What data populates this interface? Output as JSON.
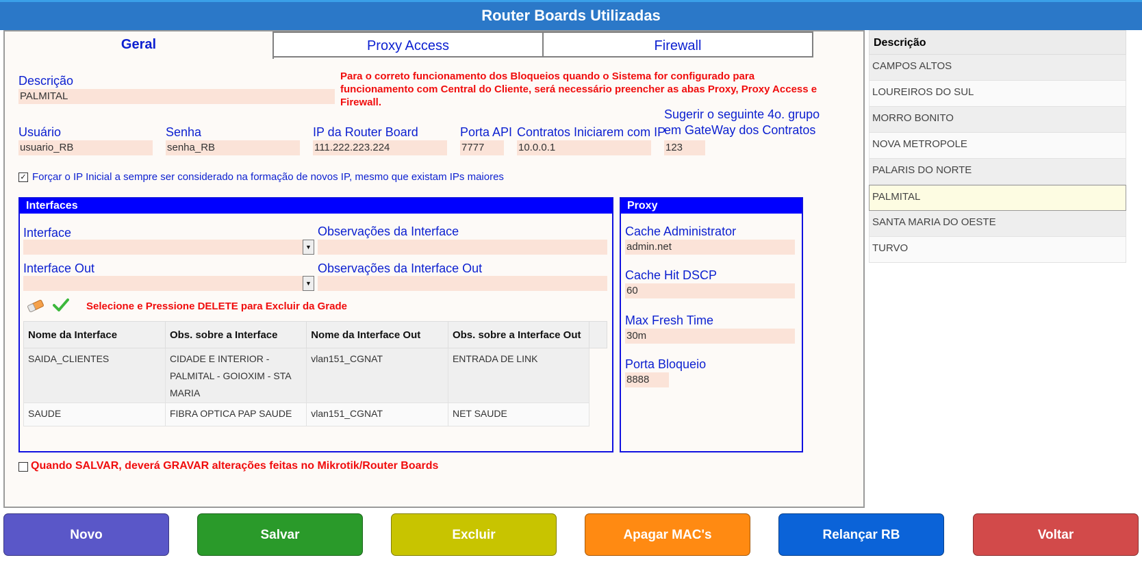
{
  "window": {
    "title": "Router Boards Utilizadas"
  },
  "tabs": [
    {
      "label": "Geral",
      "active": true
    },
    {
      "label": "Proxy Access",
      "active": false
    },
    {
      "label": "Firewall",
      "active": false
    }
  ],
  "form": {
    "descricao": {
      "label": "Descrição",
      "value": "PALMITAL"
    },
    "warning": "Para o correto funcionamento dos Bloqueios quando o Sistema for configurado para funcionamento com Central do Cliente, será necessário preencher as abas Proxy, Proxy Access e Firewall.",
    "usuario": {
      "label": "Usuário",
      "value": "usuario_RB"
    },
    "senha": {
      "label": "Senha",
      "value": "senha_RB"
    },
    "ip_router": {
      "label": "IP da Router Board",
      "value": "111.222.223.224"
    },
    "porta_api": {
      "label": "Porta API",
      "value": "7777"
    },
    "contratos_ip": {
      "label": "Contratos Iniciarem com IP",
      "value": "10.0.0.1"
    },
    "sugerir": {
      "label_line1": "Sugerir o seguinte 4o. grupo",
      "label_line2": "em GateWay dos Contratos",
      "value": "123"
    },
    "forcar_ip": {
      "label": "Forçar o IP Inicial a sempre ser considerado na formação de novos IP, mesmo que existam IPs maiores",
      "checked": true
    },
    "gravar_mikrotik": {
      "label": "Quando SALVAR, deverá GRAVAR alterações feitas no Mikrotik/Router Boards",
      "checked": false
    }
  },
  "interfaces": {
    "title": "Interfaces",
    "interface_label": "Interface",
    "interface_value": "",
    "obs_interface_label": "Observações da Interface",
    "interface_out_label": "Interface Out",
    "interface_out_value": "",
    "obs_interface_out_label": "Observações da Interface Out",
    "delete_hint": "Selecione e Pressione DELETE para Excluir da Grade",
    "grid": {
      "columns": [
        "Nome da Interface",
        "Obs. sobre a Interface",
        "Nome da Interface Out",
        "Obs. sobre a Interface Out"
      ],
      "rows": [
        [
          "SAIDA_CLIENTES",
          "CIDADE E INTERIOR - PALMITAL - GOIOXIM - STA MARIA",
          "vlan151_CGNAT",
          "ENTRADA DE LINK"
        ],
        [
          "SAUDE",
          "FIBRA OPTICA PAP SAUDE",
          "vlan151_CGNAT",
          "NET SAUDE"
        ]
      ]
    }
  },
  "proxy": {
    "title": "Proxy",
    "cache_admin": {
      "label": "Cache Administrator",
      "value": "admin.net"
    },
    "cache_hit": {
      "label": "Cache Hit DSCP",
      "value": "60"
    },
    "max_fresh": {
      "label": "Max Fresh Time",
      "value": "30m"
    },
    "porta_bloqueio": {
      "label": "Porta Bloqueio",
      "value": "8888"
    }
  },
  "side_list": {
    "header": "Descrição",
    "items": [
      "CAMPOS ALTOS",
      "LOUREIROS DO SUL",
      "MORRO BONITO",
      "NOVA METROPOLE",
      "PALARIS DO NORTE",
      "PALMITAL",
      "SANTA MARIA DO OESTE",
      "TURVO"
    ],
    "selected": "PALMITAL"
  },
  "buttons": [
    {
      "label": "Novo",
      "color": "#5a57c8"
    },
    {
      "label": "Salvar",
      "color": "#2a9a2a"
    },
    {
      "label": "Excluir",
      "color": "#c8c400"
    },
    {
      "label": "Apagar MAC's",
      "color": "#ff8a12"
    },
    {
      "label": "Relançar RB",
      "color": "#0b63d8"
    },
    {
      "label": "Voltar",
      "color": "#d24a4a"
    }
  ],
  "icons": {
    "eraser": "eraser-icon",
    "check": "check-icon"
  }
}
